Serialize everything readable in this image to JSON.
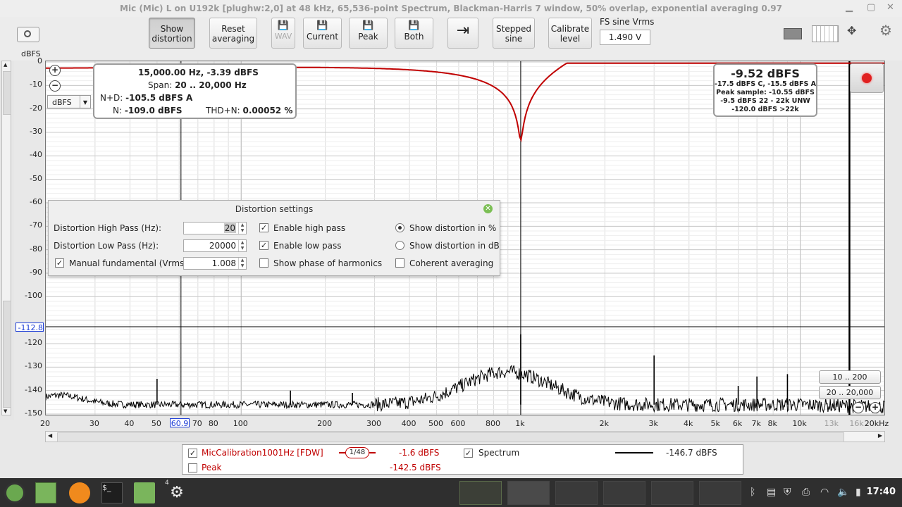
{
  "window": {
    "title": "Mic (Mic) L on U192k [plughw:2,0] at 48 kHz, 65,536-point Spectrum, Blackman-Harris 7 window, 50% overlap, exponential averaging 0.97"
  },
  "toolbar": {
    "show_distortion": "Show distortion",
    "reset_averaging": "Reset averaging",
    "wav": "WAV",
    "current": "Current",
    "peak": "Peak",
    "both": "Both",
    "stepped_sine": "Stepped sine",
    "calibrate_level": "Calibrate level",
    "fs_label": "FS sine Vrms",
    "fs_value": "1.490 V"
  },
  "axes": {
    "y_unit": "dBFS",
    "y_ticks": [
      "0",
      "-10",
      "-20",
      "-30",
      "-40",
      "-50",
      "-60",
      "-70",
      "-80",
      "-90",
      "-100",
      "-120",
      "-130",
      "-140",
      "-150"
    ],
    "y_cursor": "-112.8",
    "x_ticks": [
      "20",
      "30",
      "40",
      "50",
      "70",
      "80",
      "100",
      "200",
      "300",
      "400",
      "500",
      "600",
      "800",
      "1k",
      "2k",
      "3k",
      "4k",
      "5k",
      "6k",
      "7k",
      "8k",
      "10k",
      "13k",
      "16k",
      "20kHz"
    ],
    "x_cursor": "60.9",
    "unit_select": "dBFS"
  },
  "readout": {
    "line1": "15,000.00 Hz, -3.39 dBFS",
    "span_label": "Span:",
    "span_value": "20 .. 20,000 Hz",
    "nd_label": "N+D:",
    "nd_value": "-105.5 dBFS A",
    "n_label": "N:",
    "n_value": "-109.0 dBFS",
    "thdn_label": "THD+N:",
    "thdn_value": "0.00052 %"
  },
  "level": {
    "main": "-9.52 dBFS",
    "l1": "-17.5 dBFS C, -15.5 dBFS A",
    "l2": "Peak sample: -10.55 dBFS",
    "l3": "-9.5 dBFS 22 - 22k UNW",
    "l4": "-120.0 dBFS >22k"
  },
  "range_buttons": {
    "r1": "10 .. 200",
    "r2": "20 .. 20,000"
  },
  "distortion": {
    "title": "Distortion settings",
    "hp_label": "Distortion High Pass (Hz):",
    "hp_value": "20",
    "lp_label": "Distortion Low Pass (Hz):",
    "lp_value": "20000",
    "manual_label": "Manual fundamental (Vrms)",
    "manual_value": "1.008",
    "enable_hp": "Enable high pass",
    "enable_lp": "Enable low pass",
    "show_phase": "Show phase of harmonics",
    "show_pct": "Show distortion in %",
    "show_db": "Show distortion in dB",
    "coherent": "Coherent averaging"
  },
  "legend": {
    "cal_name": "MicCalibration1001Hz [FDW]",
    "cal_smoothing": "1/48",
    "cal_value": "-1.6 dBFS",
    "spectrum_name": "Spectrum",
    "spectrum_value": "-146.7 dBFS",
    "peak_name": "Peak",
    "peak_value": "-142.5 dBFS"
  },
  "taskbar": {
    "clock": "17:40",
    "badge": "4"
  },
  "colors": {
    "calibration_curve": "#c00000",
    "spectrum": "#000000",
    "cursor": "#1a3bd6"
  }
}
